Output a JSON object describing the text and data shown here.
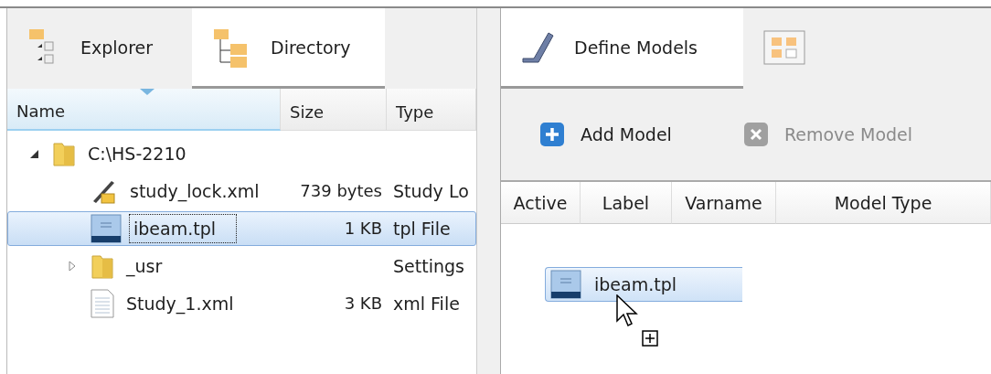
{
  "left_panel": {
    "tabs": [
      {
        "label": "Explorer",
        "kind": "explorer",
        "selected": false
      },
      {
        "label": "Directory",
        "kind": "directory",
        "selected": true
      }
    ],
    "columns": [
      {
        "label": "Name",
        "sorted": true
      },
      {
        "label": "Size",
        "sorted": false
      },
      {
        "label": "Type",
        "sorted": false
      }
    ],
    "tree": [
      {
        "name": "C:\\HS-2210",
        "kind": "folder",
        "expanded": true,
        "selected": false,
        "children": [
          {
            "name": "study_lock.xml",
            "kind": "lock",
            "size": "739 bytes",
            "type": "Study Lo",
            "selected": false
          },
          {
            "name": "ibeam.tpl",
            "kind": "template",
            "size": "1 KB",
            "type": "tpl File",
            "selected": true
          },
          {
            "name": "_usr",
            "kind": "folder",
            "type": "Settings",
            "expanded": false,
            "selected": false
          },
          {
            "name": "Study_1.xml",
            "kind": "document",
            "size": "3 KB",
            "type": "xml File",
            "selected": false
          }
        ]
      }
    ]
  },
  "right_panel": {
    "tabs": [
      {
        "label": "Define Models",
        "kind": "model",
        "selected": true
      },
      {
        "kind": "layout",
        "selected": false
      }
    ],
    "toolbar": [
      {
        "label": "Add Model",
        "kind": "add",
        "disabled": false
      },
      {
        "label": "Remove Model",
        "kind": "remove",
        "disabled": true
      }
    ],
    "columns": [
      "Active",
      "Label",
      "Varname",
      "Model Type"
    ],
    "drag_item": {
      "label": "ibeam.tpl",
      "kind": "template"
    }
  }
}
